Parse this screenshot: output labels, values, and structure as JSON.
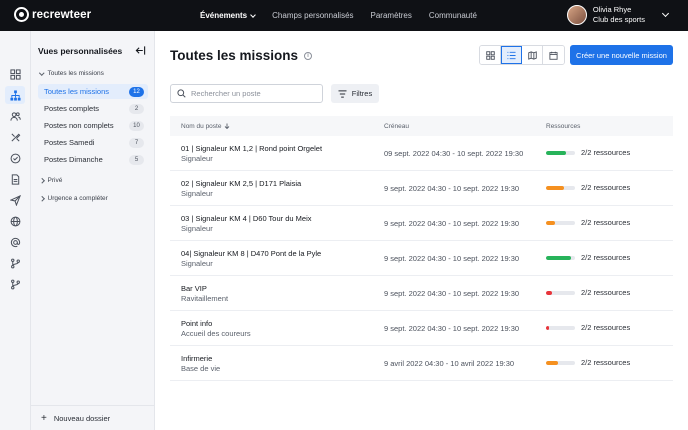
{
  "app": {
    "logo_text": "recrewteer"
  },
  "topnav": [
    {
      "label": "Événements",
      "active": true
    },
    {
      "label": "Champs personnalisés",
      "active": false
    },
    {
      "label": "Paramètres",
      "active": false
    },
    {
      "label": "Communauté",
      "active": false
    }
  ],
  "user": {
    "name": "Olivia Rhye",
    "org": "Club des sports"
  },
  "rail_icons": [
    "dashboard-icon",
    "org-chart-icon",
    "volunteers-icon",
    "tools-icon",
    "check-circle-icon",
    "document-icon",
    "send-icon",
    "globe-icon",
    "at-icon",
    "branch-icon",
    "branch-alt-icon"
  ],
  "sidebar": {
    "title": "Vues personnalisées",
    "group_all": "Toutes les missions",
    "items": [
      {
        "label": "Toutes les missions",
        "count": "12",
        "active": true
      },
      {
        "label": "Postes complets",
        "count": "2",
        "active": false
      },
      {
        "label": "Postes non complets",
        "count": "10",
        "active": false
      },
      {
        "label": "Postes Samedi",
        "count": "7",
        "active": false
      },
      {
        "label": "Postes Dimanche",
        "count": "5",
        "active": false
      }
    ],
    "group_private": "Privé",
    "group_urgent": "Urgence a compléter",
    "new_folder": "Nouveau dossier"
  },
  "main": {
    "title": "Toutes les missions",
    "create_button": "Créer une nouvelle mission",
    "search_placeholder": "Rechercher un poste",
    "filters_label": "Filtres"
  },
  "table": {
    "columns": {
      "name": "Nom du poste",
      "slot": "Créneau",
      "resources": "Ressources"
    },
    "rows": [
      {
        "title": "01 | Signaleur KM 1,2 | Rond point Orgelet",
        "sub": "Signaleur",
        "slot": "09 sept. 2022 04:30 - 10 sept. 2022 19:30",
        "resources": "2/2 ressources",
        "fill": 0.7,
        "color": "#27b35a"
      },
      {
        "title": "02 | Signaleur KM 2,5 | D171 Plaisia",
        "sub": "Signaleur",
        "slot": "9 sept. 2022 04:30 - 10 sept. 2022 19:30",
        "resources": "2/2 ressources",
        "fill": 0.62,
        "color": "#f5901f"
      },
      {
        "title": "03 | Signaleur KM 4 | D60 Tour du Meix",
        "sub": "Signaleur",
        "slot": "9 sept. 2022 04:30 - 10 sept. 2022 19:30",
        "resources": "2/2 ressources",
        "fill": 0.32,
        "color": "#f5901f"
      },
      {
        "title": "04| Signaleur KM 8 | D470 Pont de la Pyle",
        "sub": "Signaleur",
        "slot": "9 sept. 2022 04:30 - 10 sept. 2022 19:30",
        "resources": "2/2 ressources",
        "fill": 0.85,
        "color": "#27b35a"
      },
      {
        "title": "Bar VIP",
        "sub": "Ravitaillement",
        "slot": "9 sept. 2022 04:30 - 10 sept. 2022 19:30",
        "resources": "2/2 ressources",
        "fill": 0.22,
        "color": "#e8343a"
      },
      {
        "title": "Point info",
        "sub": "Accueil des coureurs",
        "slot": "9 sept. 2022 04:30 - 10 sept. 2022 19:30",
        "resources": "2/2 ressources",
        "fill": 0.1,
        "color": "#e8343a"
      },
      {
        "title": "Infirmerie",
        "sub": "Base de vie",
        "slot": "9 avril 2022 04:30 - 10 avril 2022 19:30",
        "resources": "2/2 ressources",
        "fill": 0.42,
        "color": "#f5901f"
      }
    ]
  }
}
